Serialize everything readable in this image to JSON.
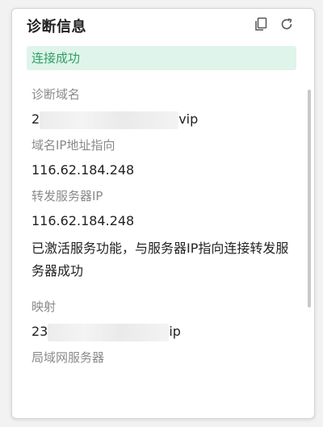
{
  "panel": {
    "title": "诊断信息",
    "copy_icon": "copy-icon",
    "refresh_icon": "refresh-icon"
  },
  "status": {
    "text": "连接成功",
    "color": "#2f9e62",
    "background": "#dff4ea"
  },
  "fields": [
    {
      "label": "诊断域名",
      "value_prefix": "2",
      "value_suffix": "vip"
    },
    {
      "label": "域名IP地址指向",
      "value": "116.62.184.248"
    },
    {
      "label": "转发服务器IP",
      "value": "116.62.184.248"
    },
    {
      "note": "已激活服务功能，与服务器IP指向连接转发服务器成功"
    },
    {
      "label": "映射",
      "value_prefix": "23",
      "value_suffix": "ip"
    },
    {
      "label": "局域网服务器"
    }
  ]
}
